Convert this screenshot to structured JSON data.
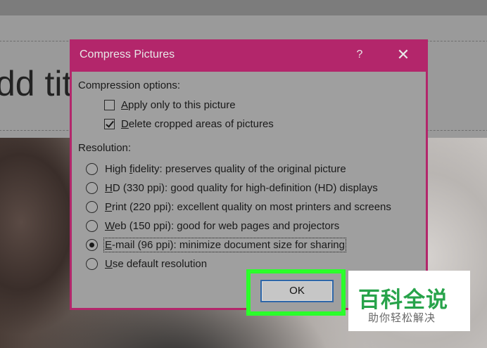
{
  "background": {
    "title_text": "dd tit"
  },
  "dialog": {
    "title": "Compress Pictures",
    "help_glyph": "?",
    "close_glyph": "✕",
    "compression_label": "Compression options:",
    "options": [
      {
        "label_u": "A",
        "label_rest": "pply only to this picture",
        "checked": false
      },
      {
        "label_u": "D",
        "label_rest": "elete cropped areas of pictures",
        "checked": true
      }
    ],
    "resolution_label": "Resolution:",
    "resolutions": [
      {
        "pre": "High ",
        "u": "f",
        "post": "idelity: preserves quality of the original picture",
        "selected": false
      },
      {
        "pre": "",
        "u": "H",
        "post": "D (330 ppi): good quality for high-definition (HD) displays",
        "selected": false
      },
      {
        "pre": "",
        "u": "P",
        "post": "rint (220 ppi): excellent quality on most printers and screens",
        "selected": false
      },
      {
        "pre": "",
        "u": "W",
        "post": "eb (150 ppi): good for web pages and projectors",
        "selected": false
      },
      {
        "pre": "",
        "u": "E",
        "post": "-mail (96 ppi): minimize document size for sharing",
        "selected": true
      },
      {
        "pre": "",
        "u": "U",
        "post": "se default resolution",
        "selected": false
      }
    ],
    "ok_label": "OK"
  },
  "watermark": {
    "logo": "百科全说",
    "subtitle": "助你轻松解决"
  },
  "colors": {
    "dialog_frame": "#b3266b",
    "highlight": "#2bff2b",
    "watermark_green": "#27a34a"
  }
}
